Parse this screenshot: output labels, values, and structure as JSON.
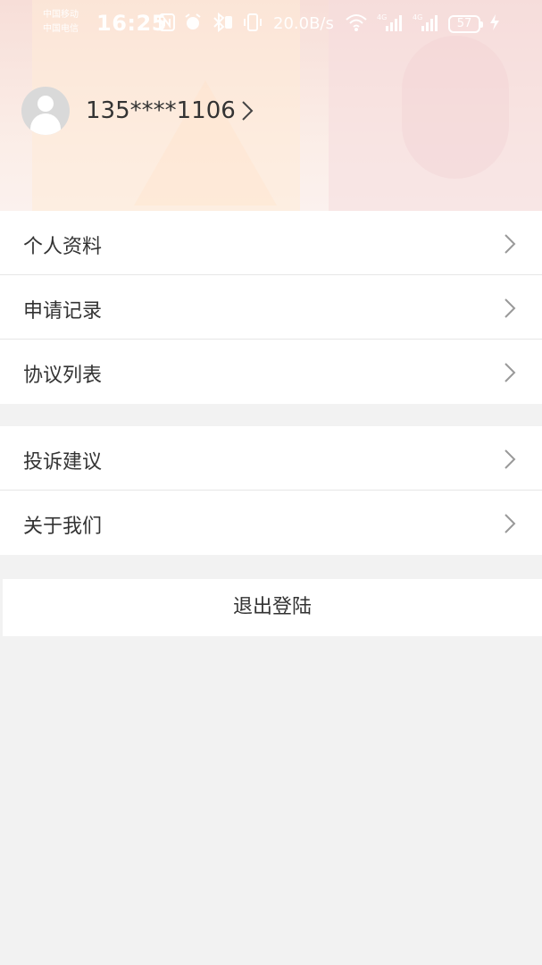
{
  "status_bar": {
    "carrier_1": "中国移动",
    "carrier_2": "中国电信",
    "time": "16:25",
    "network_speed": "20.0B/s",
    "battery_level": "57",
    "icons": [
      "nfc-icon",
      "alarm-icon",
      "bluetooth-icon",
      "vibrate-icon",
      "wifi-icon",
      "signal-4g-icon",
      "signal-4g-icon",
      "charging-icon"
    ]
  },
  "profile": {
    "phone": "135****1106"
  },
  "menu_group_1": [
    {
      "label": "个人资料"
    },
    {
      "label": "申请记录"
    },
    {
      "label": "协议列表"
    }
  ],
  "menu_group_2": [
    {
      "label": "投诉建议"
    },
    {
      "label": "关于我们"
    }
  ],
  "logout": {
    "label": "退出登陆"
  },
  "colors": {
    "background": "#f2f2f2",
    "card": "#ffffff",
    "text": "#333333",
    "chevron": "#999999"
  }
}
